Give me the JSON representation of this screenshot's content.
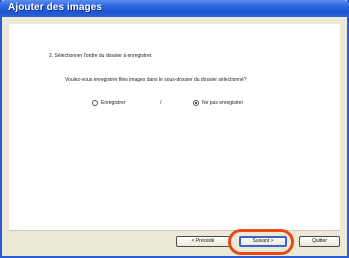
{
  "window": {
    "title": "Ajouter des images"
  },
  "content": {
    "step": "2. Sélectionner l'ordre du dossier à enregistrer.",
    "question": "Voulez-vous enregistrer files images dans le sous-dossier du dossier sélectionné?",
    "options": [
      {
        "label": "Enregistrer",
        "checked": false
      },
      {
        "label": "Ne pas enregistrer",
        "checked": true
      }
    ],
    "separator": "/"
  },
  "buttons": {
    "prev": "< Précédé",
    "next": "Suivant >",
    "quit": "Quitter"
  },
  "colors": {
    "highlight": "#e84a12",
    "titlebar": "#2a60d8"
  }
}
